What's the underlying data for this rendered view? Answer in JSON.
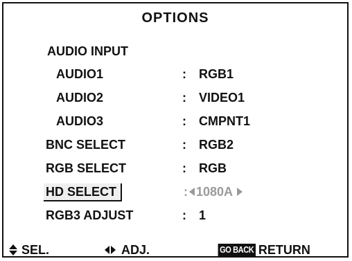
{
  "menu": {
    "title": "OPTIONS",
    "audio_input_label": "AUDIO INPUT",
    "separator": ":",
    "audio_items": [
      {
        "label": "AUDIO1",
        "value": "RGB1"
      },
      {
        "label": "AUDIO2",
        "value": "VIDEO1"
      },
      {
        "label": "AUDIO3",
        "value": "CMPNT1"
      }
    ],
    "items": [
      {
        "label": "BNC SELECT",
        "value": "RGB2"
      },
      {
        "label": "RGB SELECT",
        "value": "RGB"
      }
    ],
    "hd_select": {
      "label": "HD SELECT",
      "value": "1080A",
      "selected": true,
      "dimmed_value": true
    },
    "rgb3_adjust": {
      "label": "RGB3 ADJUST",
      "value": "1"
    }
  },
  "footer": {
    "sel_label": "SEL.",
    "adj_label": "ADJ.",
    "goback_badge": "GO BACK",
    "return_label": "RETURN",
    "icons": {
      "sel": "up-down-arrow-icon",
      "adj": "left-right-arrow-icon"
    }
  }
}
